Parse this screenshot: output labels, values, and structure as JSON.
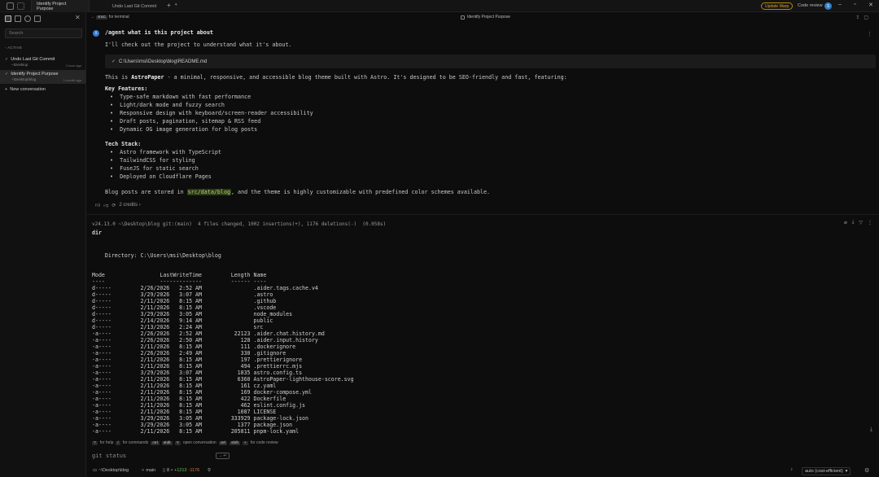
{
  "tabs": [
    {
      "label": "Identify Project Purpose",
      "active": true
    },
    {
      "label": "Undo Last Git Commit",
      "active": false
    }
  ],
  "topbar": {
    "update_label": "Update Warp",
    "code_review_label": "Code review",
    "avatar_initial": "S"
  },
  "sidebar": {
    "search_placeholder": "Search",
    "section_label": "ACTIVE",
    "conversations": [
      {
        "title": "Undo Last Git Commit",
        "path": "~\\Desktop",
        "time": "1 hour ago"
      },
      {
        "title": "Identify Project Purpose",
        "path": "~\\Desktop\\blog",
        "time": "1 month ago"
      }
    ],
    "new_conversation_label": "New conversation"
  },
  "main_header": {
    "back_key": "ESC",
    "back_label": "for terminal",
    "project_label": "Identify Project Purpose"
  },
  "agent": {
    "query": "/agent what is this project about",
    "intro": "I'll check out the project to understand what it's about.",
    "tool_path": "C:\\Users\\msi\\Desktop\\blog\\README.md",
    "desc_pre": "This is ",
    "desc_name": "AstroPaper",
    "desc_post": " - a minimal, responsive, and accessible blog theme built with Astro. It's designed to be SEO-friendly and fast, featuring:",
    "features_heading": "Key Features:",
    "features": [
      "Type-safe markdown with fast performance",
      "Light/dark mode and fuzzy search",
      "Responsive design with keyboard/screen-reader accessibility",
      "Draft posts, pagination, sitemap & RSS feed",
      "Dynamic OG image generation for blog posts"
    ],
    "stack_heading": "Tech Stack:",
    "stack": [
      "Astro framework with TypeScript",
      "TailwindCSS for styling",
      "FuseJS for static search",
      "Deployed on Cloudflare Pages"
    ],
    "footer_pre": "Blog posts are stored in ",
    "footer_code": "src/data/blog",
    "footer_post": ", and the theme is highly customizable with predefined color schemes available.",
    "credits": "2 credits"
  },
  "terminal": {
    "prompt": "v24.13.0 ~\\Desktop\\blog git:(main)  4 files changed, 1002 insertions(+), 1176 deletions(-)  (0.058s)",
    "command": "dir",
    "directory_line": "    Directory: C:\\Users\\msi\\Desktop\\blog",
    "header": "Mode                 LastWriteTime         Length Name",
    "rule": "----                 -------------         ------ ----",
    "rows": [
      "d-----         2/26/2026   2:52 AM                .aider.tags.cache.v4",
      "d-----         3/29/2026   3:07 AM                .astro",
      "d-----         2/11/2026   8:15 AM                .github",
      "d-----         2/11/2026   8:15 AM                .vscode",
      "d-----         3/29/2026   3:05 AM                node_modules",
      "d-----         2/14/2026   9:14 AM                public",
      "d-----         2/13/2026   2:24 AM                src",
      "-a----         2/26/2026   2:52 AM          22123 .aider.chat.history.md",
      "-a----         2/26/2026   2:50 AM            128 .aider.input.history",
      "-a----         2/11/2026   8:15 AM            111 .dockerignore",
      "-a----         2/26/2026   2:49 AM            330 .gitignore",
      "-a----         2/11/2026   8:15 AM            197 .prettierignore",
      "-a----         2/11/2026   8:15 AM            494 .prettierrc.mjs",
      "-a----         3/29/2026   3:07 AM           1835 astro.config.ts",
      "-a----         2/11/2026   8:15 AM           6360 AstroPaper-lighthouse-score.svg",
      "-a----         2/11/2026   8:15 AM            161 cz.yaml",
      "-a----         2/11/2026   8:15 AM            169 docker-compose.yml",
      "-a----         2/11/2026   8:15 AM            422 Dockerfile",
      "-a----         2/11/2026   8:15 AM            462 eslint.config.js",
      "-a----         2/11/2026   8:15 AM           1087 LICENSE",
      "-a----         3/29/2026   3:05 AM         333929 package-lock.json",
      "-a----         3/29/2026   3:05 AM           1377 package.json",
      "-a----         2/11/2026   8:15 AM         205811 pnpm-lock.yaml"
    ]
  },
  "helpbar": {
    "help_key": "?",
    "help_label": "for help",
    "cmd_key": "/",
    "cmd_label": "for commands",
    "open_keys": [
      "ctrl",
      "shift",
      "Y"
    ],
    "open_label": "open conversation",
    "review_keys": [
      "ctrl",
      "shift",
      "+"
    ],
    "review_label": "for code review"
  },
  "input": {
    "command": "git status",
    "tag": "→ ↵"
  },
  "statusbar": {
    "path": "~\\Desktop\\blog",
    "branch": "main",
    "files": "8",
    "added": "+1213",
    "removed": "-1176",
    "model": "auto (cost-efficient)"
  },
  "colors": {
    "accent_info": "#3a7bd5",
    "added": "#6fbf5c",
    "removed": "#e0763a",
    "update": "#e0a52a"
  }
}
